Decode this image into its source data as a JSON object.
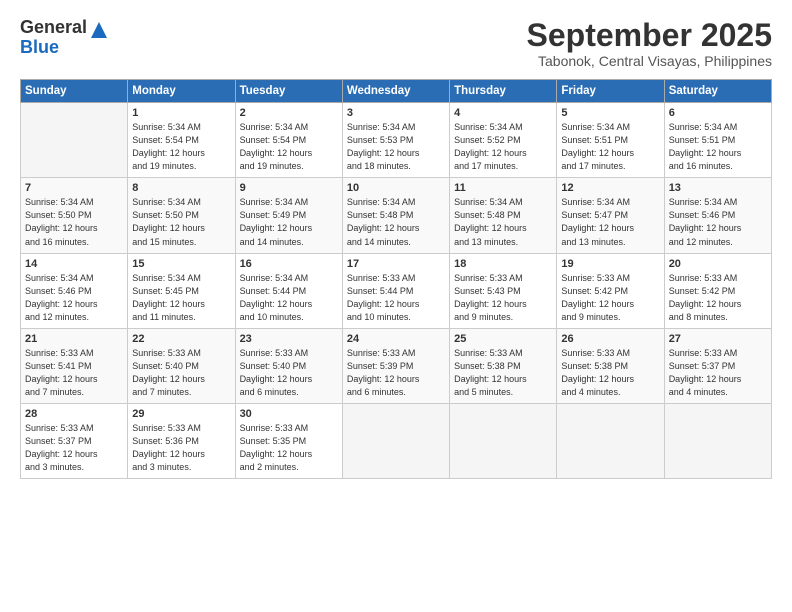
{
  "logo": {
    "general": "General",
    "blue": "Blue"
  },
  "title": "September 2025",
  "location": "Tabonok, Central Visayas, Philippines",
  "headers": [
    "Sunday",
    "Monday",
    "Tuesday",
    "Wednesday",
    "Thursday",
    "Friday",
    "Saturday"
  ],
  "weeks": [
    [
      {
        "day": "",
        "info": ""
      },
      {
        "day": "1",
        "info": "Sunrise: 5:34 AM\nSunset: 5:54 PM\nDaylight: 12 hours\nand 19 minutes."
      },
      {
        "day": "2",
        "info": "Sunrise: 5:34 AM\nSunset: 5:54 PM\nDaylight: 12 hours\nand 19 minutes."
      },
      {
        "day": "3",
        "info": "Sunrise: 5:34 AM\nSunset: 5:53 PM\nDaylight: 12 hours\nand 18 minutes."
      },
      {
        "day": "4",
        "info": "Sunrise: 5:34 AM\nSunset: 5:52 PM\nDaylight: 12 hours\nand 17 minutes."
      },
      {
        "day": "5",
        "info": "Sunrise: 5:34 AM\nSunset: 5:51 PM\nDaylight: 12 hours\nand 17 minutes."
      },
      {
        "day": "6",
        "info": "Sunrise: 5:34 AM\nSunset: 5:51 PM\nDaylight: 12 hours\nand 16 minutes."
      }
    ],
    [
      {
        "day": "7",
        "info": "Sunrise: 5:34 AM\nSunset: 5:50 PM\nDaylight: 12 hours\nand 16 minutes."
      },
      {
        "day": "8",
        "info": "Sunrise: 5:34 AM\nSunset: 5:50 PM\nDaylight: 12 hours\nand 15 minutes."
      },
      {
        "day": "9",
        "info": "Sunrise: 5:34 AM\nSunset: 5:49 PM\nDaylight: 12 hours\nand 14 minutes."
      },
      {
        "day": "10",
        "info": "Sunrise: 5:34 AM\nSunset: 5:48 PM\nDaylight: 12 hours\nand 14 minutes."
      },
      {
        "day": "11",
        "info": "Sunrise: 5:34 AM\nSunset: 5:48 PM\nDaylight: 12 hours\nand 13 minutes."
      },
      {
        "day": "12",
        "info": "Sunrise: 5:34 AM\nSunset: 5:47 PM\nDaylight: 12 hours\nand 13 minutes."
      },
      {
        "day": "13",
        "info": "Sunrise: 5:34 AM\nSunset: 5:46 PM\nDaylight: 12 hours\nand 12 minutes."
      }
    ],
    [
      {
        "day": "14",
        "info": "Sunrise: 5:34 AM\nSunset: 5:46 PM\nDaylight: 12 hours\nand 12 minutes."
      },
      {
        "day": "15",
        "info": "Sunrise: 5:34 AM\nSunset: 5:45 PM\nDaylight: 12 hours\nand 11 minutes."
      },
      {
        "day": "16",
        "info": "Sunrise: 5:34 AM\nSunset: 5:44 PM\nDaylight: 12 hours\nand 10 minutes."
      },
      {
        "day": "17",
        "info": "Sunrise: 5:33 AM\nSunset: 5:44 PM\nDaylight: 12 hours\nand 10 minutes."
      },
      {
        "day": "18",
        "info": "Sunrise: 5:33 AM\nSunset: 5:43 PM\nDaylight: 12 hours\nand 9 minutes."
      },
      {
        "day": "19",
        "info": "Sunrise: 5:33 AM\nSunset: 5:42 PM\nDaylight: 12 hours\nand 9 minutes."
      },
      {
        "day": "20",
        "info": "Sunrise: 5:33 AM\nSunset: 5:42 PM\nDaylight: 12 hours\nand 8 minutes."
      }
    ],
    [
      {
        "day": "21",
        "info": "Sunrise: 5:33 AM\nSunset: 5:41 PM\nDaylight: 12 hours\nand 7 minutes."
      },
      {
        "day": "22",
        "info": "Sunrise: 5:33 AM\nSunset: 5:40 PM\nDaylight: 12 hours\nand 7 minutes."
      },
      {
        "day": "23",
        "info": "Sunrise: 5:33 AM\nSunset: 5:40 PM\nDaylight: 12 hours\nand 6 minutes."
      },
      {
        "day": "24",
        "info": "Sunrise: 5:33 AM\nSunset: 5:39 PM\nDaylight: 12 hours\nand 6 minutes."
      },
      {
        "day": "25",
        "info": "Sunrise: 5:33 AM\nSunset: 5:38 PM\nDaylight: 12 hours\nand 5 minutes."
      },
      {
        "day": "26",
        "info": "Sunrise: 5:33 AM\nSunset: 5:38 PM\nDaylight: 12 hours\nand 4 minutes."
      },
      {
        "day": "27",
        "info": "Sunrise: 5:33 AM\nSunset: 5:37 PM\nDaylight: 12 hours\nand 4 minutes."
      }
    ],
    [
      {
        "day": "28",
        "info": "Sunrise: 5:33 AM\nSunset: 5:37 PM\nDaylight: 12 hours\nand 3 minutes."
      },
      {
        "day": "29",
        "info": "Sunrise: 5:33 AM\nSunset: 5:36 PM\nDaylight: 12 hours\nand 3 minutes."
      },
      {
        "day": "30",
        "info": "Sunrise: 5:33 AM\nSunset: 5:35 PM\nDaylight: 12 hours\nand 2 minutes."
      },
      {
        "day": "",
        "info": ""
      },
      {
        "day": "",
        "info": ""
      },
      {
        "day": "",
        "info": ""
      },
      {
        "day": "",
        "info": ""
      }
    ]
  ]
}
